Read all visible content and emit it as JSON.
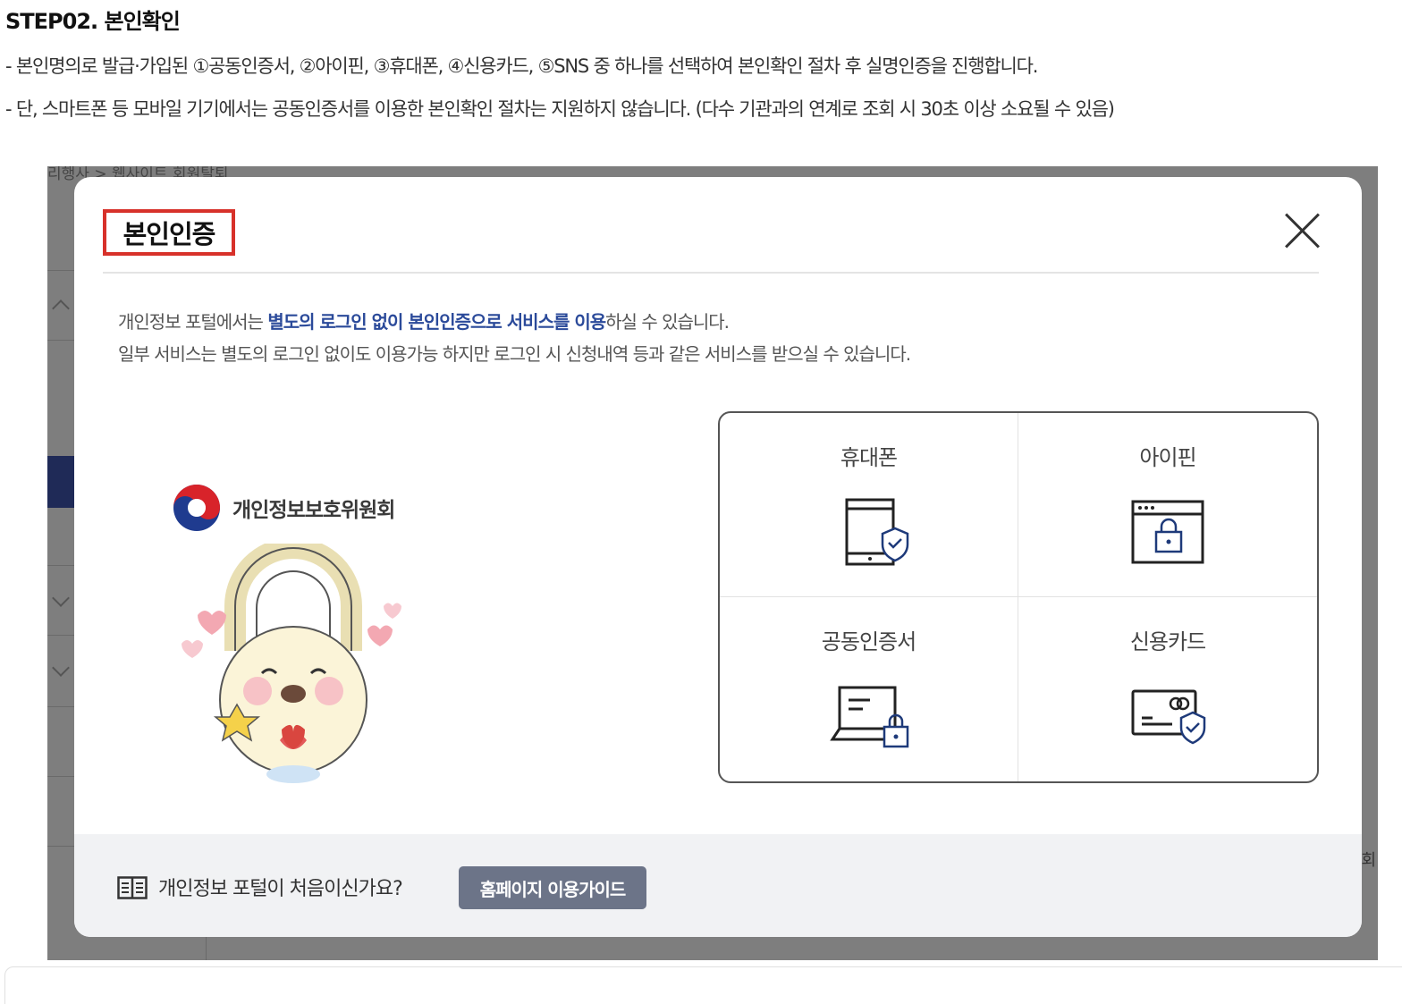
{
  "step": {
    "title": "STEP02. 본인확인",
    "desc1": "- 본인명의로 발급·가입된 ①공동인증서, ②아이핀, ③휴대폰, ④신용카드, ⑤SNS 중 하나를 선택하여 본인확인 절차 후 실명인증을 진행합니다.",
    "desc2": "- 단, 스마트폰 등 모바일 기기에서는 공동인증서를 이용한 본인확인 절차는 지원하지 않습니다. (다수 기관과의 연계로 조회 시 30초 이상 소요될 수 있음)"
  },
  "background": {
    "breadcrumb": "리행사 > 웹사이트 회원탈퇴",
    "right_text": "|회"
  },
  "modal": {
    "title": "본인인증",
    "intro1_pre": "개인정보 포털에서는 ",
    "intro1_hl": "별도의 로그인 없이 본인인증으로 서비스를 이용",
    "intro1_post": "하실 수 있습니다.",
    "intro2": "일부 서비스는 별도의 로그인 없이도 이용가능 하지만 로그인 시 신청내역 등과 같은 서비스를 받으실 수 있습니다.",
    "logo_text": "개인정보보호위원회",
    "options": [
      {
        "label": "휴대폰",
        "icon": "mobile-shield-icon"
      },
      {
        "label": "아이핀",
        "icon": "browser-lock-icon"
      },
      {
        "label": "공동인증서",
        "icon": "laptop-lock-icon"
      },
      {
        "label": "신용카드",
        "icon": "card-shield-icon"
      }
    ],
    "footer": {
      "question": "개인정보 포털이 처음이신가요?",
      "guide_button": "홈페이지 이용가이드"
    }
  },
  "colors": {
    "highlight_box": "#d7312a",
    "accent_text": "#2b4a9a",
    "guide_button_bg": "#6c7488",
    "sidebar_active": "#1f2a57"
  }
}
